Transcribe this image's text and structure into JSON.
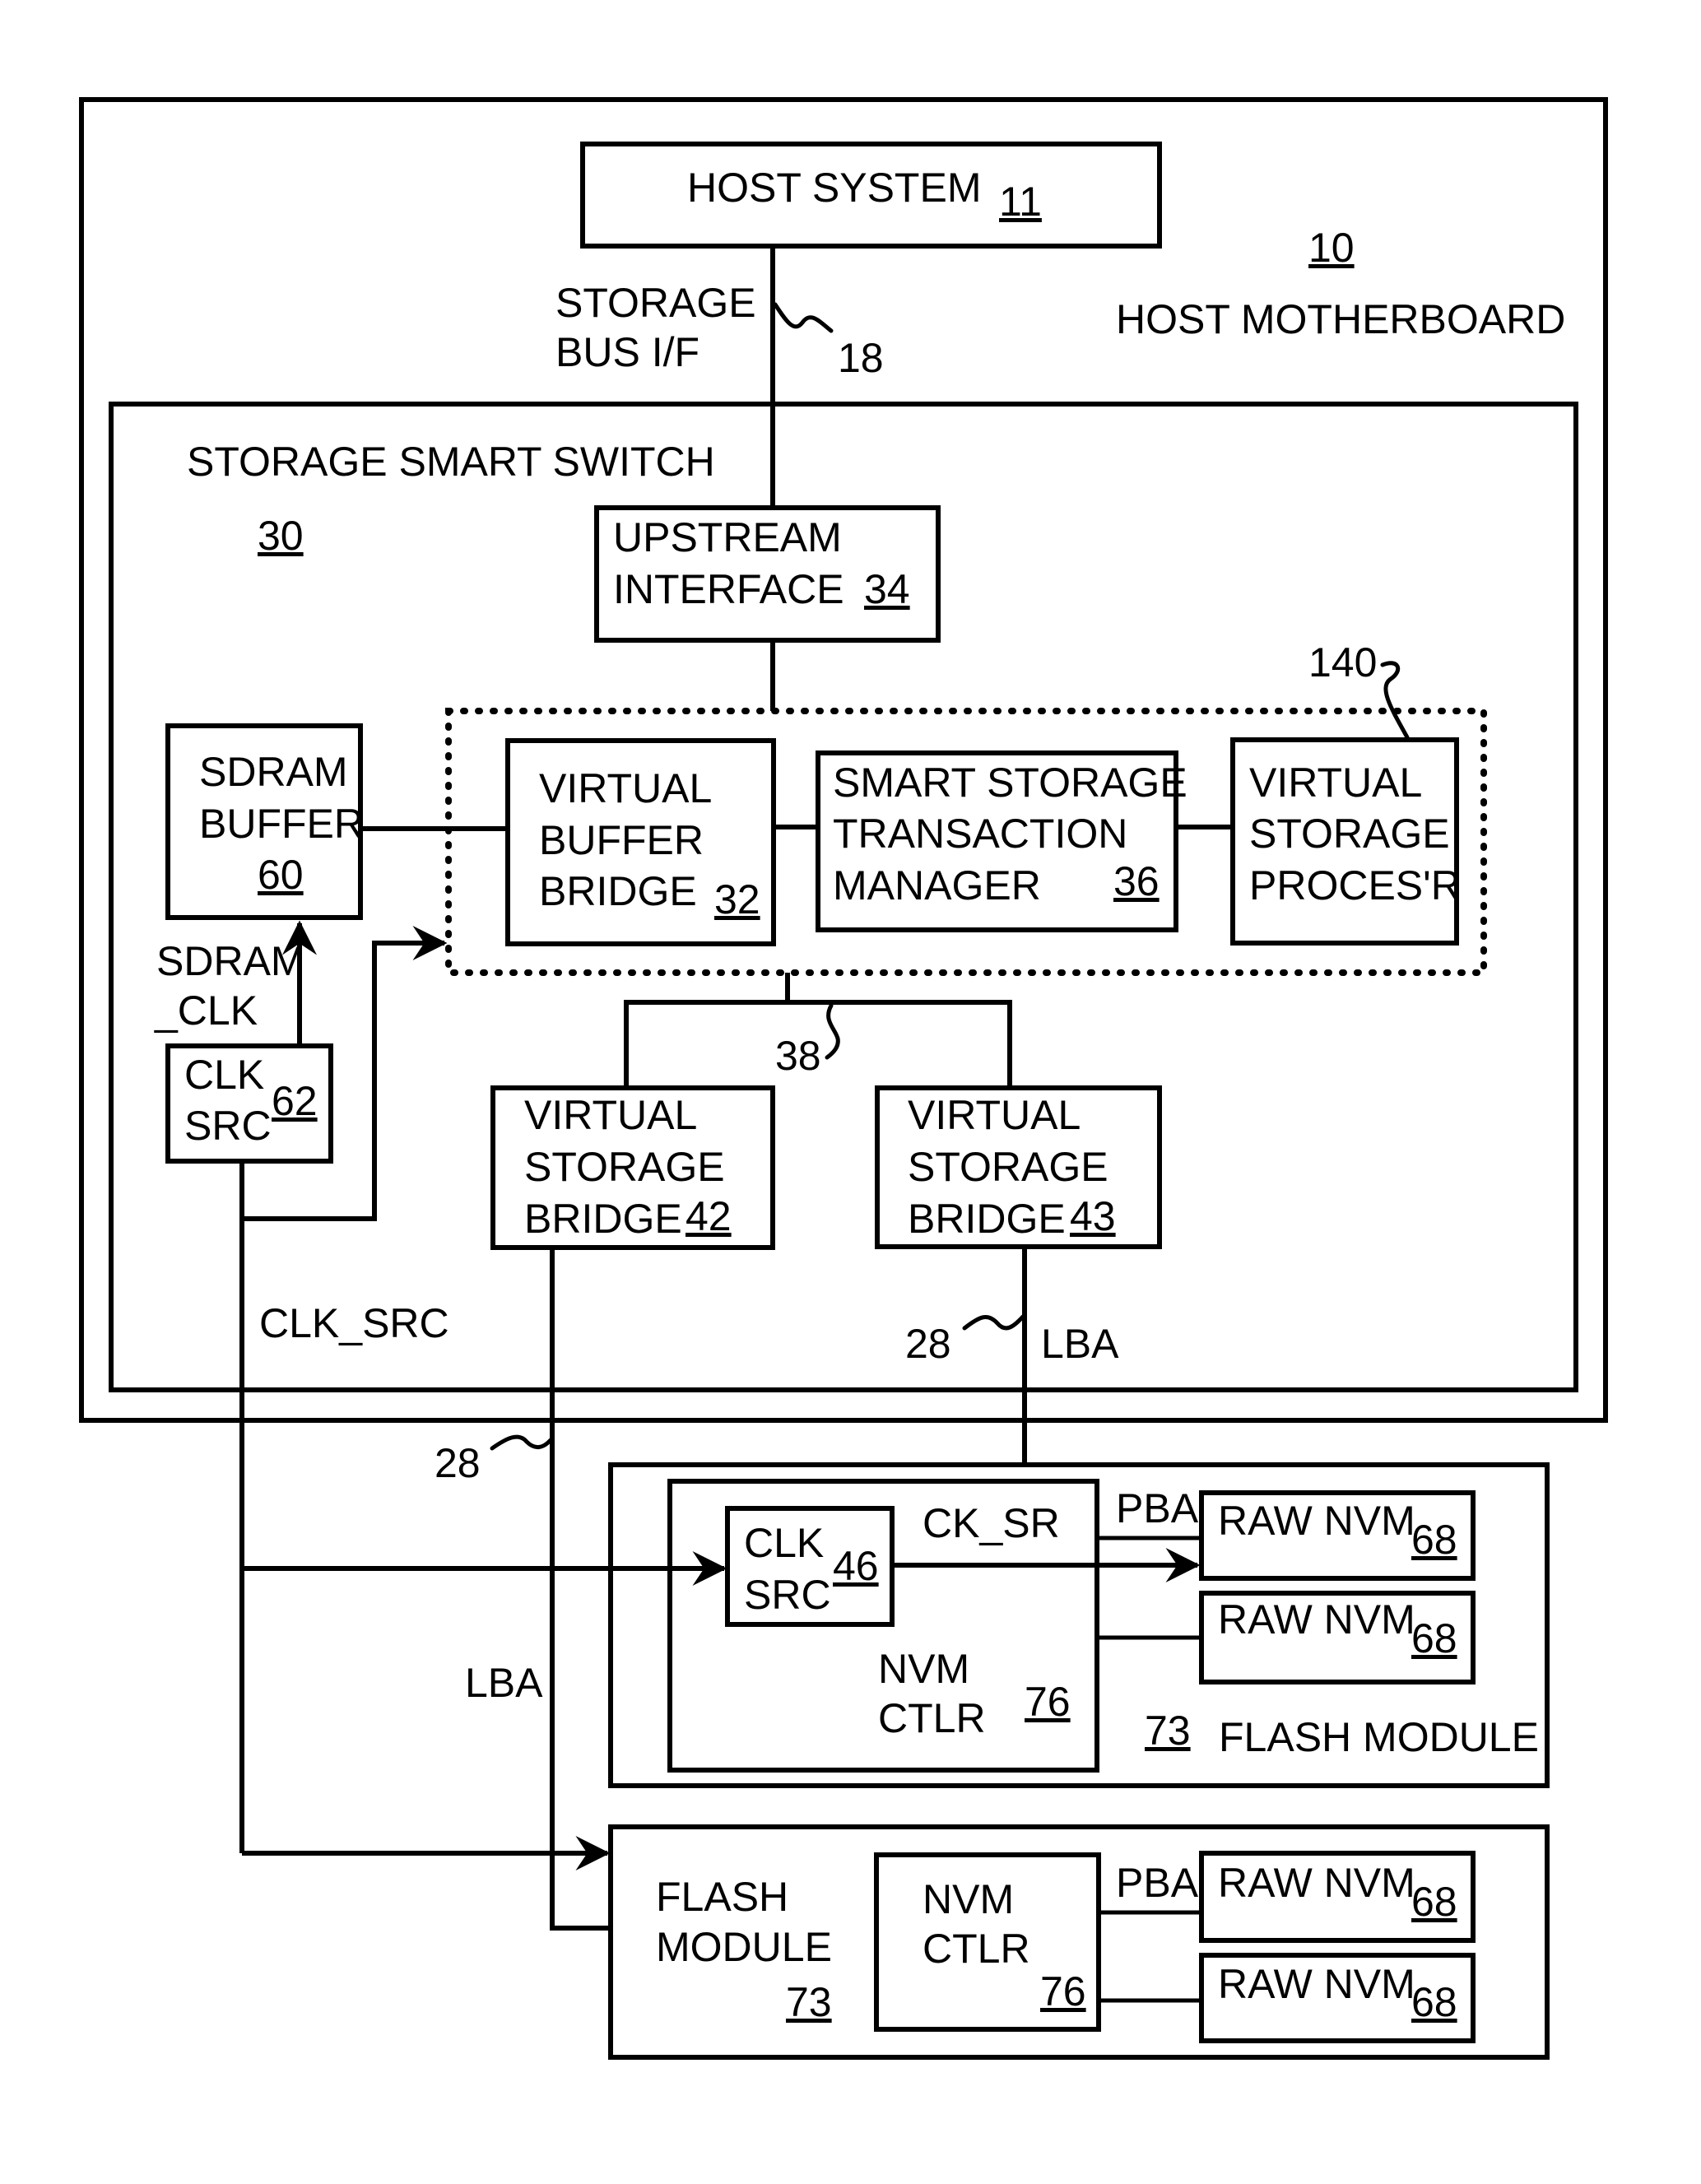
{
  "motherboard": {
    "label": "HOST MOTHERBOARD",
    "ref": "10"
  },
  "host_system": {
    "label": "HOST SYSTEM",
    "ref": "11"
  },
  "storage_bus": {
    "line1": "STORAGE",
    "line2": "BUS I/F",
    "ref": "18"
  },
  "smart_switch": {
    "label": "STORAGE SMART SWITCH",
    "ref": "30"
  },
  "upstream_interface": {
    "line1": "UPSTREAM",
    "line2": "INTERFACE",
    "ref": "34"
  },
  "group_ref": "140",
  "sdram_buffer": {
    "line1": "SDRAM",
    "line2": "BUFFER",
    "ref": "60"
  },
  "virtual_buffer_bridge": {
    "line1": "VIRTUAL",
    "line2": "BUFFER",
    "line3": "BRIDGE",
    "ref": "32"
  },
  "transaction_manager": {
    "line1": "SMART STORAGE",
    "line2": "TRANSACTION",
    "line3": "MANAGER",
    "ref": "36"
  },
  "virtual_storage_processor": {
    "line1": "VIRTUAL",
    "line2": "STORAGE",
    "line3": "PROCES'R"
  },
  "sdram_clk": {
    "line1": "SDRAM",
    "line2": "_CLK"
  },
  "clk_src_62": {
    "line1": "CLK",
    "line2": "SRC",
    "ref": "62"
  },
  "internal_bus_ref": "38",
  "vsb_42": {
    "line1": "VIRTUAL",
    "line2": "STORAGE",
    "line3": "BRIDGE",
    "ref": "42"
  },
  "vsb_43": {
    "line1": "VIRTUAL",
    "line2": "STORAGE",
    "line3": "BRIDGE",
    "ref": "43"
  },
  "clk_src_signal": "CLK_SRC",
  "lba_bus": {
    "ref": "28",
    "label": "LBA"
  },
  "flash_module_1": {
    "label": "FLASH MODULE",
    "ref": "73",
    "clk_src": {
      "line1": "CLK",
      "line2": "SRC",
      "ref": "46"
    },
    "ck_sr": "CK_SR",
    "pba": "PBA",
    "nvm_ctlr": {
      "line1": "NVM",
      "line2": "CTLR",
      "ref": "76"
    },
    "raw_nvm": [
      {
        "label": "RAW NVM",
        "ref": "68"
      },
      {
        "label": "RAW NVM",
        "ref": "68"
      }
    ]
  },
  "flash_module_2": {
    "line1": "FLASH",
    "line2": "MODULE",
    "ref": "73",
    "pba": "PBA",
    "nvm_ctlr": {
      "line1": "NVM",
      "line2": "CTLR",
      "ref": "76"
    },
    "raw_nvm": [
      {
        "label": "RAW NVM",
        "ref": "68"
      },
      {
        "label": "RAW NVM",
        "ref": "68"
      }
    ]
  }
}
